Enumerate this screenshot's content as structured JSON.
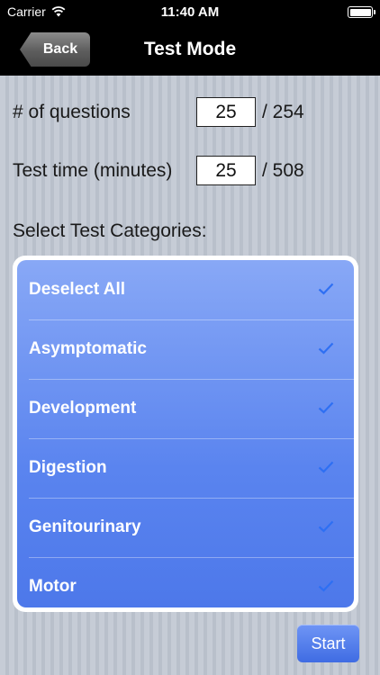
{
  "status_bar": {
    "carrier": "Carrier",
    "time": "11:40 AM",
    "wifi_icon": "wifi-icon",
    "battery_icon": "battery-icon"
  },
  "nav": {
    "back_label": "Back",
    "title": "Test Mode"
  },
  "questions": {
    "label": "# of questions",
    "value": "25",
    "total": "/ 254"
  },
  "test_time": {
    "label": "Test time (minutes)",
    "value": "25",
    "total": "/ 508"
  },
  "categories": {
    "heading": "Select Test Categories:",
    "check_icon": "checkmark-icon",
    "check_color": "#2e6ff3",
    "items": [
      {
        "label": "Deselect All",
        "checked": true
      },
      {
        "label": "Asymptomatic",
        "checked": true
      },
      {
        "label": "Development",
        "checked": true
      },
      {
        "label": "Digestion",
        "checked": true
      },
      {
        "label": "Genitourinary",
        "checked": true
      },
      {
        "label": "Motor",
        "checked": true
      }
    ]
  },
  "start_label": "Start"
}
